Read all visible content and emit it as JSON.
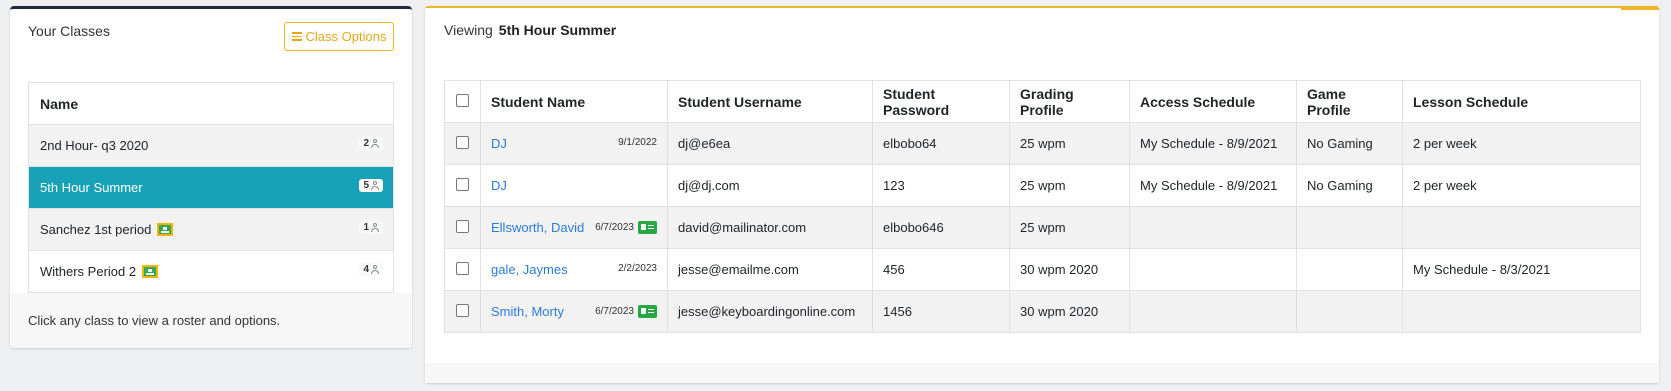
{
  "classes_panel": {
    "title": "Your Classes",
    "options_label": "Class Options",
    "column_header": "Name",
    "items": [
      {
        "name": "2nd Hour- q3 2020",
        "count": "2",
        "google_classroom": false
      },
      {
        "name": "5th Hour Summer",
        "count": "5",
        "google_classroom": false,
        "active": true
      },
      {
        "name": "Sanchez 1st period",
        "count": "1",
        "google_classroom": true
      },
      {
        "name": "Withers Period 2",
        "count": "4",
        "google_classroom": true
      }
    ],
    "footer": "Click any class to view a roster and options."
  },
  "roster": {
    "viewing_label": "Viewing",
    "class_name": "5th Hour Summer",
    "columns": [
      "Student Name",
      "Student Username",
      "Student Password",
      "Grading Profile",
      "Access Schedule",
      "Game Profile",
      "Lesson Schedule"
    ],
    "rows": [
      {
        "name": "DJ",
        "date": "9/1/2022",
        "id_badge": false,
        "username": "dj@e6ea",
        "password": "elbobo64",
        "grading": "25 wpm",
        "access": "My Schedule - 8/9/2021",
        "game": "No Gaming",
        "lesson": "2 per week"
      },
      {
        "name": "DJ",
        "date": "",
        "id_badge": false,
        "username": "dj@dj.com",
        "password": "123",
        "grading": "25 wpm",
        "access": "My Schedule - 8/9/2021",
        "game": "No Gaming",
        "lesson": "2 per week"
      },
      {
        "name": "Ellsworth, David",
        "date": "6/7/2023",
        "id_badge": true,
        "username": "david@mailinator.com",
        "password": "elbobo646",
        "grading": "25 wpm",
        "access": "",
        "game": "",
        "lesson": ""
      },
      {
        "name": "gale, Jaymes",
        "date": "2/2/2023",
        "id_badge": false,
        "username": "jesse@emailme.com",
        "password": "456",
        "grading": "30 wpm 2020",
        "access": "",
        "game": "",
        "lesson": "My Schedule - 8/3/2021"
      },
      {
        "name": "Smith, Morty",
        "date": "6/7/2023",
        "id_badge": true,
        "username": "jesse@keyboardingonline.com",
        "password": "1456",
        "grading": "30 wpm 2020",
        "access": "",
        "game": "",
        "lesson": ""
      }
    ]
  },
  "colors": {
    "accent_teal": "#17a2b8",
    "accent_gold": "#f0b429",
    "link": "#2a7bde",
    "badge_green": "#28a745"
  }
}
